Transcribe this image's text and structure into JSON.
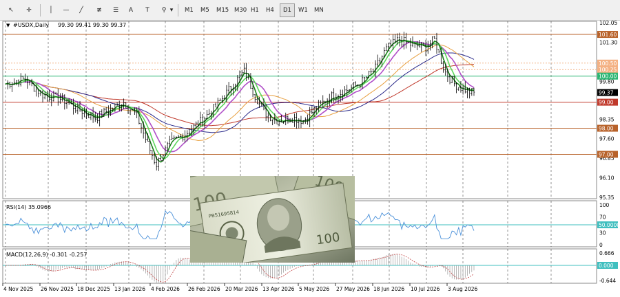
{
  "toolbar": {
    "tools": [
      {
        "name": "cursor-icon",
        "glyph": "↖"
      },
      {
        "name": "crosshair-icon",
        "glyph": "✛"
      },
      {
        "name": "vertical-line-icon",
        "glyph": "│"
      },
      {
        "name": "horizontal-line-icon",
        "glyph": "—"
      },
      {
        "name": "trendline-icon",
        "glyph": "╱"
      },
      {
        "name": "equidistant-channel-icon",
        "glyph": "≢"
      },
      {
        "name": "fibonacci-icon",
        "glyph": "☰"
      },
      {
        "name": "text-icon",
        "glyph": "A"
      },
      {
        "name": "text-label-icon",
        "glyph": "T"
      },
      {
        "name": "shapes-icon",
        "glyph": "⚲"
      }
    ],
    "timeframes": [
      "M1",
      "M5",
      "M15",
      "M30",
      "H1",
      "H4",
      "D1",
      "W1",
      "MN"
    ],
    "active_timeframe": "D1"
  },
  "chart_header": {
    "symbol": "#USDX,Daily",
    "ohlc": "99.30 99.41 99.30 99.37"
  },
  "price_axis": {
    "ticks": [
      "102.05",
      "101.30",
      "100.50",
      "99.80",
      "98.35",
      "97.60",
      "96.85",
      "96.10",
      "95.35"
    ],
    "tags": [
      {
        "label": "101.60",
        "value": 101.6,
        "color": "#b8622a"
      },
      {
        "label": "100.50",
        "value": 100.5,
        "color": "#f4b183"
      },
      {
        "label": "100.25",
        "value": 100.25,
        "color": "#f4b183"
      },
      {
        "label": "100.00",
        "value": 100.0,
        "color": "#2bb673"
      },
      {
        "label": "99.37",
        "value": 99.37,
        "color": "#000000",
        "text_color": "#ffffff"
      },
      {
        "label": "99.00",
        "value": 99.0,
        "color": "#c0392b"
      },
      {
        "label": "98.00",
        "value": 98.0,
        "color": "#b8622a"
      },
      {
        "label": "97.00",
        "value": 97.0,
        "color": "#b8622a"
      }
    ]
  },
  "rsi": {
    "label": "RSI(14) 35.0966",
    "ticks": [
      "100",
      "70",
      "30",
      "0"
    ],
    "level_tag": "50.0000"
  },
  "macd": {
    "label": "MACD(12,26,9) -0.301 -0.257",
    "ticks": [
      "0.666",
      "-0.644"
    ],
    "level_tag": "0.000"
  },
  "time_axis": {
    "labels": [
      "4 Nov 2025",
      "26 Nov 2025",
      "18 Dec 2025",
      "13 Jan 2026",
      "4 Feb 2026",
      "26 Feb 2026",
      "20 Mar 2026",
      "13 Apr 2026",
      "5 May 2026",
      "27 May 2026",
      "18 Jun 2026",
      "10 Jul 2026",
      "3 Aug 2026"
    ]
  },
  "colors": {
    "candles": "#000000",
    "ema_fast": "#1a7f1a",
    "ema_fast2": "#5cd65c",
    "ma_violet": "#b04fc8",
    "ma_orange": "#e8a040",
    "ma_navy": "#2a2a8a",
    "ma_red": "#c0392b",
    "rsi_line": "#4a90d9",
    "macd_hist": "#c04040",
    "level_cyan": "#3fbfbf"
  }
}
